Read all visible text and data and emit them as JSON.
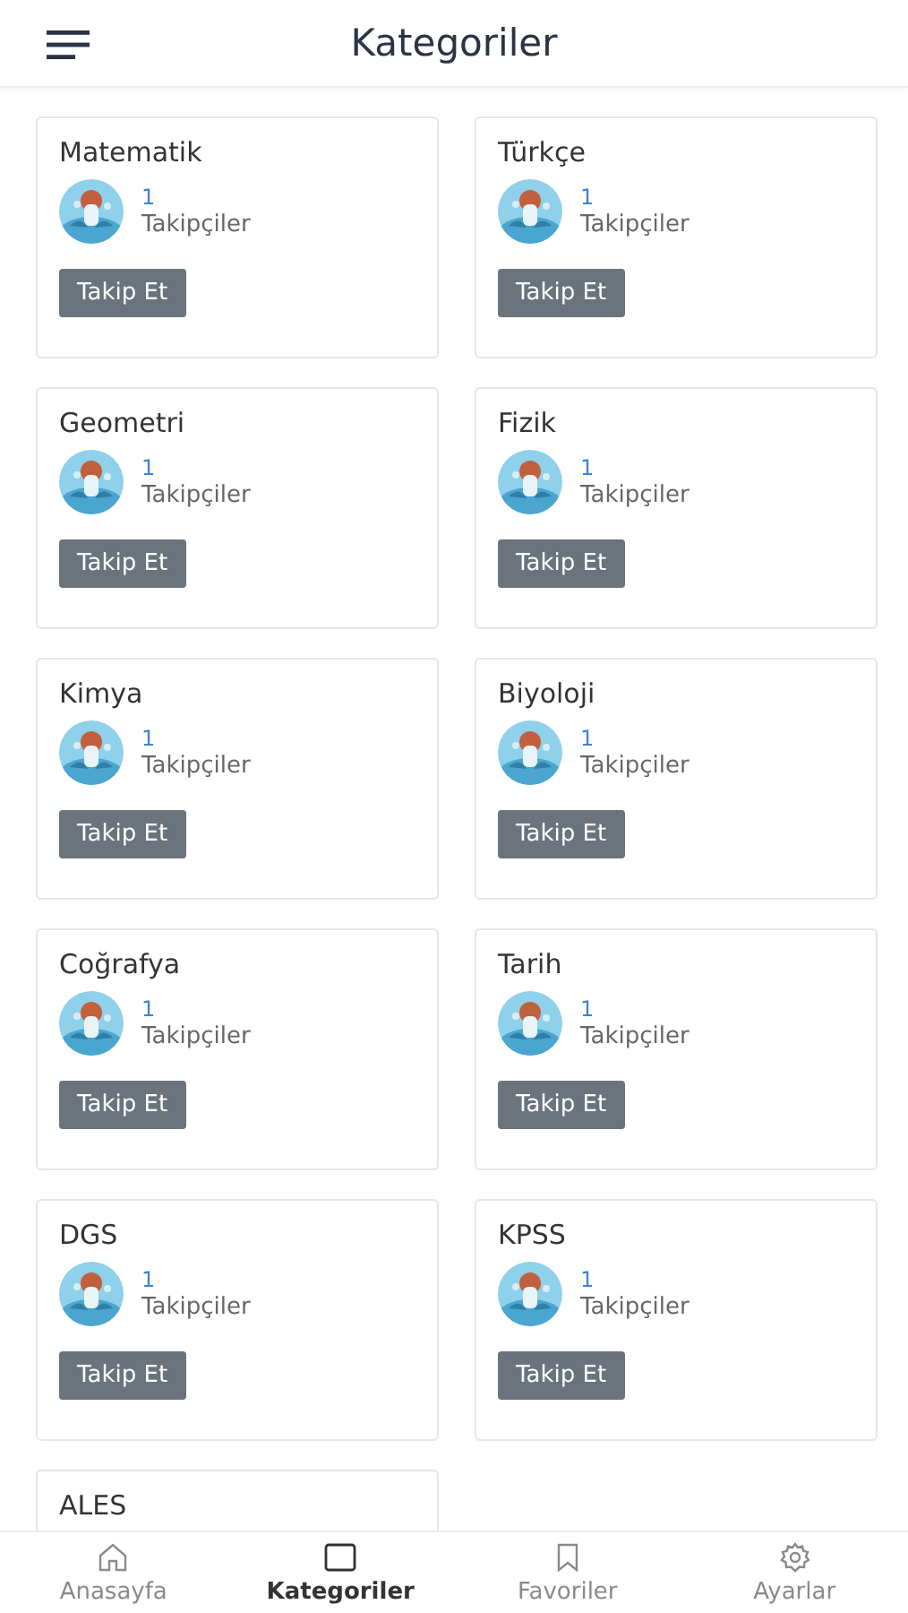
{
  "header": {
    "title": "Kategoriler"
  },
  "categories": [
    {
      "name": "Matematik",
      "followers": "1",
      "followers_label": "Takipçiler",
      "button": "Takip Et"
    },
    {
      "name": "Türkçe",
      "followers": "1",
      "followers_label": "Takipçiler",
      "button": "Takip Et"
    },
    {
      "name": "Geometri",
      "followers": "1",
      "followers_label": "Takipçiler",
      "button": "Takip Et"
    },
    {
      "name": "Fizik",
      "followers": "1",
      "followers_label": "Takipçiler",
      "button": "Takip Et"
    },
    {
      "name": "Kimya",
      "followers": "1",
      "followers_label": "Takipçiler",
      "button": "Takip Et"
    },
    {
      "name": "Biyoloji",
      "followers": "1",
      "followers_label": "Takipçiler",
      "button": "Takip Et"
    },
    {
      "name": "Coğrafya",
      "followers": "1",
      "followers_label": "Takipçiler",
      "button": "Takip Et"
    },
    {
      "name": "Tarih",
      "followers": "1",
      "followers_label": "Takipçiler",
      "button": "Takip Et"
    },
    {
      "name": "DGS",
      "followers": "1",
      "followers_label": "Takipçiler",
      "button": "Takip Et"
    },
    {
      "name": "KPSS",
      "followers": "1",
      "followers_label": "Takipçiler",
      "button": "Takip Et"
    },
    {
      "name": "ALES"
    }
  ],
  "bottom_nav": [
    {
      "label": "Anasayfa",
      "kind": "home",
      "selected": false
    },
    {
      "label": "Kategoriler",
      "kind": "square",
      "selected": true
    },
    {
      "label": "Favoriler",
      "kind": "bookmark",
      "selected": false
    },
    {
      "label": "Ayarlar",
      "kind": "gear",
      "selected": false
    }
  ]
}
